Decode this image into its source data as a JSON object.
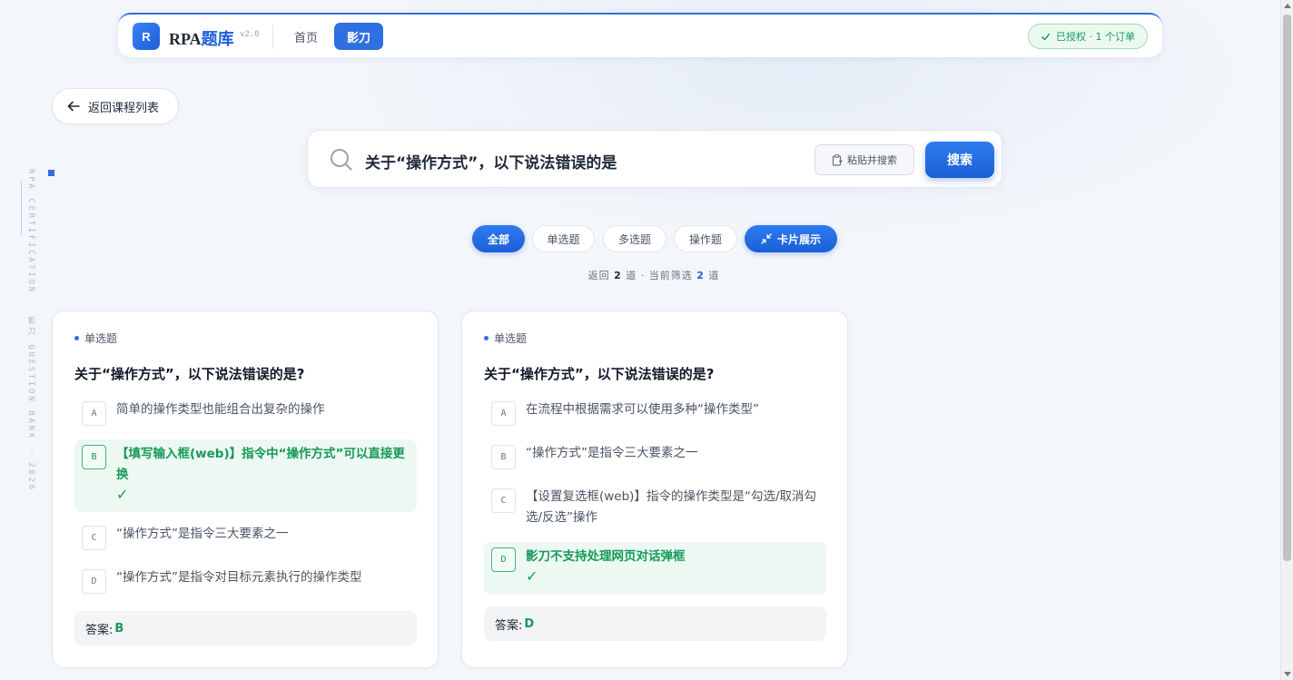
{
  "header": {
    "logo_letter": "R",
    "brand_prefix": "RPA",
    "brand_suffix": "题库",
    "version": "v2.0",
    "nav": [
      {
        "label": "首页"
      },
      {
        "label": "影刀"
      }
    ],
    "auth_badge": "已授权 · 1 个订单"
  },
  "back_button": {
    "label": "返回课程列表"
  },
  "side_text": "RPA CERTIFICATION · 影刀 QUESTION BANK · 2026",
  "search": {
    "query": "关于“操作方式”，以下说法错误的是",
    "paste_label": "粘贴并搜索",
    "search_label": "搜索"
  },
  "filters": {
    "all": "全部",
    "single": "单选题",
    "multi": "多选题",
    "operation": "操作题",
    "view_mode": "卡片展示"
  },
  "result": {
    "prefix": "返回",
    "total": "2",
    "unit1": "道 · 当前筛选",
    "filtered": "2",
    "unit2": "道"
  },
  "cards": [
    {
      "type": "单选题",
      "question": "关于“操作方式”，以下说法错误的是?",
      "options": [
        {
          "letter": "A",
          "text": "简单的操作类型也能组合出复杂的操作"
        },
        {
          "letter": "B",
          "text": "【填写输入框(web)】指令中“操作方式”可以直接更换",
          "check": "✓"
        },
        {
          "letter": "C",
          "text": "“操作方式”是指令三大要素之一"
        },
        {
          "letter": "D",
          "text": "“操作方式”是指令对目标元素执行的操作类型"
        }
      ],
      "answer_label": "答案:",
      "answer": "B"
    },
    {
      "type": "单选题",
      "question": "关于“操作方式”，以下说法错误的是?",
      "options": [
        {
          "letter": "A",
          "text": "在流程中根据需求可以使用多种“操作类型”"
        },
        {
          "letter": "B",
          "text": "“操作方式”是指令三大要素之一"
        },
        {
          "letter": "C",
          "text": "【设置复选框(web)】指令的操作类型是“勾选/取消勾选/反选”操作"
        },
        {
          "letter": "D",
          "text": "影刀不支持处理网页对话弹框",
          "check": "✓"
        }
      ],
      "answer_label": "答案:",
      "answer": "D"
    }
  ]
}
